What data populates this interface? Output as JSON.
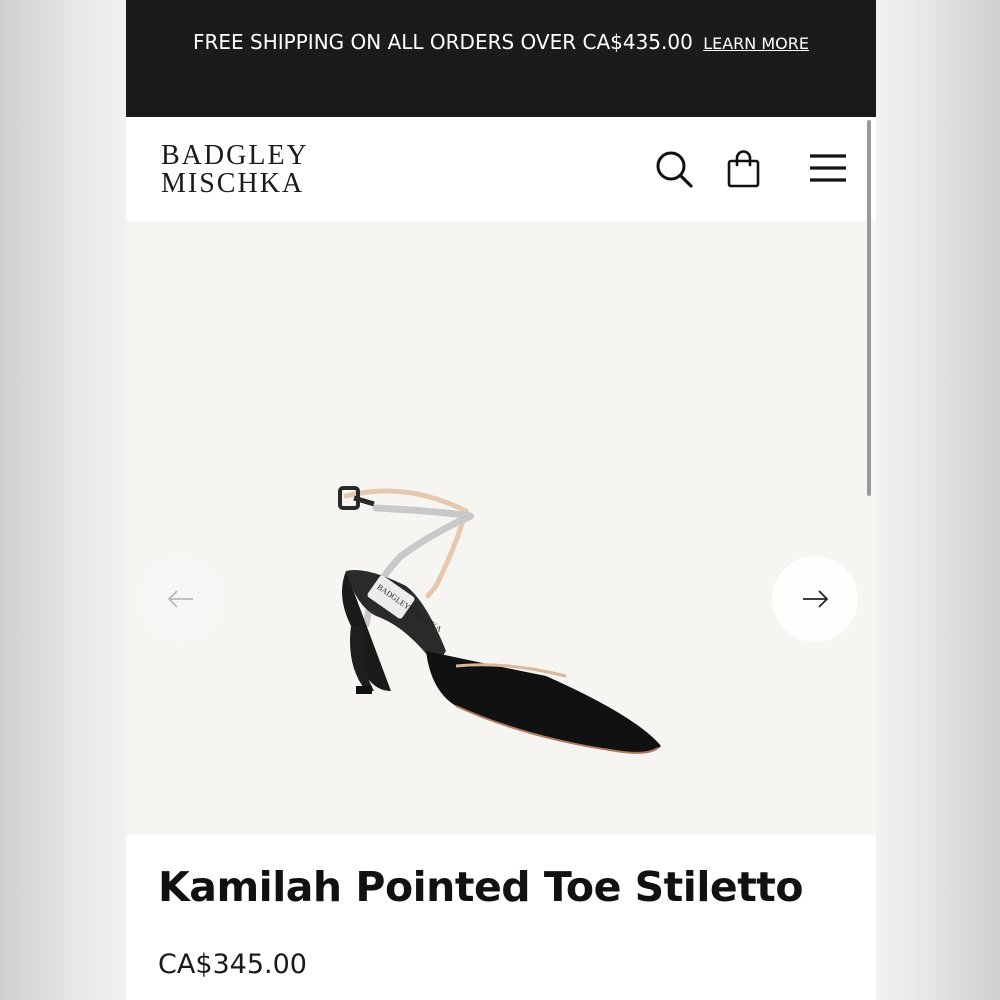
{
  "promo": {
    "text": "FREE SHIPPING ON ALL ORDERS OVER CA$435.00",
    "link": "LEARN MORE"
  },
  "header": {
    "logo_line1": "BADGLEY",
    "logo_line2": "MISCHKA",
    "icons": [
      "search-icon",
      "shopping-bag-icon",
      "hamburger-menu-icon"
    ]
  },
  "gallery": {
    "image_brand_label": "BADGLEY MISCHKA",
    "prev_icon": "arrow-left-icon",
    "next_icon": "arrow-right-icon"
  },
  "product": {
    "title": "Kamilah Pointed Toe Stiletto",
    "price": "CA$345.00"
  },
  "colors": {
    "promo_bg": "#1b1b1b",
    "gallery_bg": "#f7f5f2",
    "text": "#111111"
  }
}
